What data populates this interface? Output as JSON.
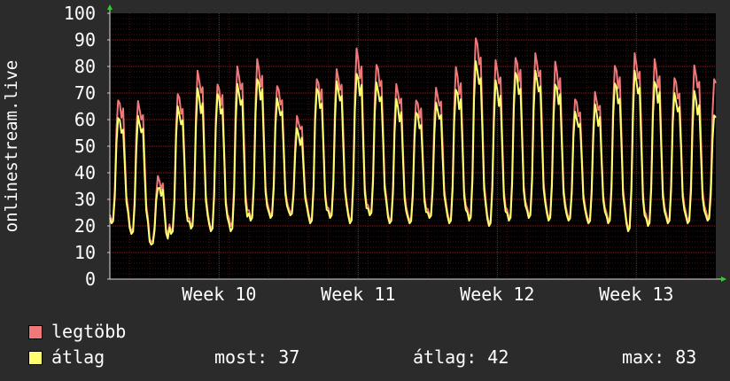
{
  "chart_data": {
    "type": "line",
    "ylabel": "onlinestream.live",
    "ylim": [
      0,
      100
    ],
    "yticks": [
      0,
      10,
      20,
      30,
      40,
      50,
      60,
      70,
      80,
      90,
      100
    ],
    "xticks": [
      "Week 10",
      "Week 11",
      "Week 12",
      "Week 13"
    ],
    "x_unit": "days",
    "xlim": [
      0,
      30.5
    ],
    "xtick_positions": [
      5.5,
      12.5,
      19.5,
      26.5
    ],
    "grid": true,
    "background": "#000000",
    "grid_color": "#5a1f1f",
    "series": [
      {
        "name": "legtöbb",
        "color": "#f07878",
        "daily_peaks": [
          68,
          67,
          38,
          70,
          78,
          74,
          80,
          82,
          73,
          61,
          76,
          79,
          86,
          81,
          73,
          68,
          72,
          79,
          91,
          82,
          84,
          85,
          81,
          68,
          70,
          81,
          85,
          82,
          76,
          80,
          76,
          51
        ],
        "daily_lows": [
          22,
          18,
          14,
          18,
          20,
          19,
          20,
          23,
          24,
          25,
          22,
          24,
          22,
          25,
          22,
          22,
          24,
          22,
          23,
          21,
          23,
          24,
          23,
          23,
          22,
          22,
          19,
          21,
          22,
          22,
          23,
          25
        ]
      },
      {
        "name": "átlag",
        "color": "#ffff70",
        "daily_peaks": [
          61,
          61,
          35,
          65,
          71,
          70,
          73,
          76,
          68,
          56,
          72,
          74,
          78,
          74,
          67,
          63,
          66,
          72,
          82,
          74,
          78,
          78,
          74,
          63,
          65,
          74,
          78,
          75,
          70,
          70,
          62,
          37
        ],
        "daily_lows": [
          21,
          17,
          13,
          17,
          19,
          18,
          18,
          22,
          23,
          24,
          21,
          23,
          21,
          24,
          21,
          21,
          23,
          21,
          22,
          20,
          22,
          23,
          22,
          22,
          21,
          21,
          18,
          20,
          21,
          21,
          22,
          24
        ]
      }
    ]
  },
  "legend": {
    "max_label": "legtöbb",
    "avg_label": "átlag",
    "max_color": "#f07878",
    "avg_color": "#ffff70"
  },
  "stats": {
    "now": "most: 37",
    "avg": "átlag: 42",
    "max": "max: 83"
  }
}
